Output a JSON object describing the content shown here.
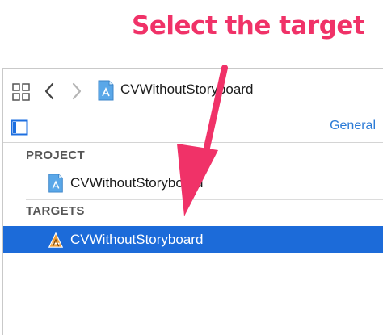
{
  "annotation": {
    "text": "Select the target"
  },
  "pathbar": {
    "file_name": "CVWithoutStoryboard"
  },
  "editor": {
    "tab_general": "General"
  },
  "project": {
    "header": "PROJECT",
    "items": [
      {
        "label": "CVWithoutStoryboard",
        "icon": "project-file-icon"
      }
    ]
  },
  "targets": {
    "header": "TARGETS",
    "items": [
      {
        "label": "CVWithoutStoryboard",
        "icon": "app-target-icon",
        "selected": true
      }
    ]
  },
  "colors": {
    "annotation": "#f03268",
    "selection": "#1c6bd9",
    "link": "#2a7ad6"
  }
}
